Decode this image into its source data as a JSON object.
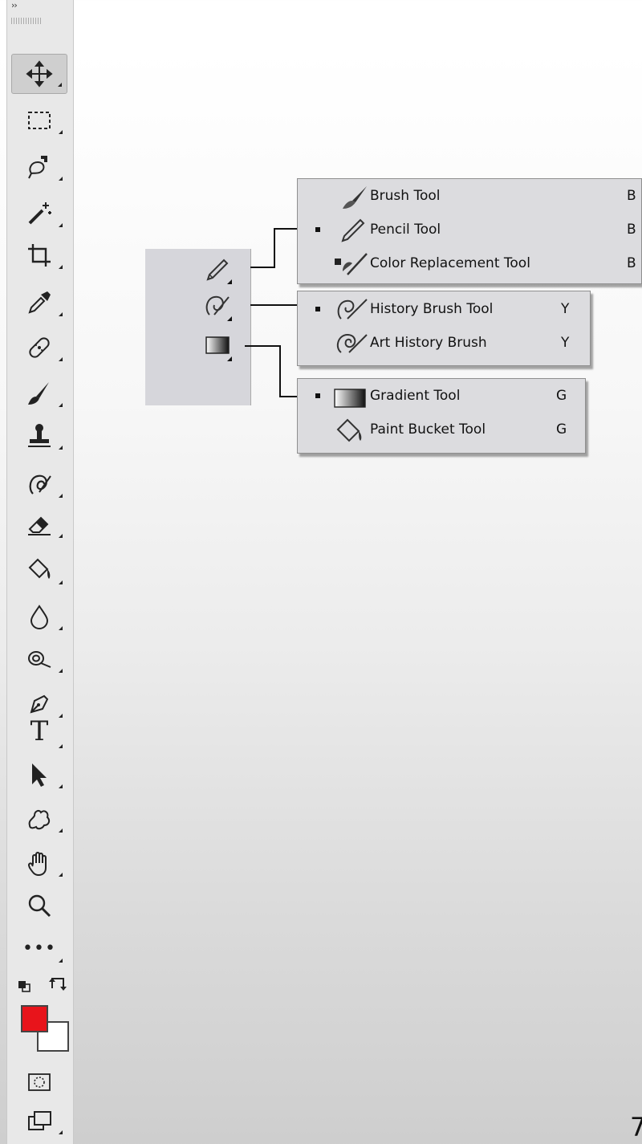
{
  "toolbar": {
    "expand_label": "››",
    "tools": [
      {
        "name": "move-tool",
        "icon": "move-icon"
      },
      {
        "name": "marquee-tool",
        "icon": "rect-marquee-icon"
      },
      {
        "name": "lasso-tool",
        "icon": "magnetic-lasso-icon"
      },
      {
        "name": "magic-wand-tool",
        "icon": "magic-wand-icon"
      },
      {
        "name": "crop-tool",
        "icon": "crop-icon"
      },
      {
        "name": "eyedropper-tool",
        "icon": "eyedropper-icon"
      },
      {
        "name": "healing-brush-tool",
        "icon": "bandage-icon"
      },
      {
        "name": "brush-tool",
        "icon": "brush-icon"
      },
      {
        "name": "clone-stamp-tool",
        "icon": "stamp-icon"
      },
      {
        "name": "history-brush-tool",
        "icon": "history-brush-icon"
      },
      {
        "name": "eraser-tool",
        "icon": "eraser-icon"
      },
      {
        "name": "paint-bucket-tool",
        "icon": "paint-bucket-icon"
      },
      {
        "name": "blur-tool",
        "icon": "drop-icon"
      },
      {
        "name": "dodge-tool",
        "icon": "dodge-icon"
      },
      {
        "name": "pen-tool",
        "icon": "pen-icon"
      },
      {
        "name": "type-tool",
        "icon": "type-icon"
      },
      {
        "name": "path-selection-tool",
        "icon": "arrow-icon"
      },
      {
        "name": "custom-shape-tool",
        "icon": "puzzle-icon"
      },
      {
        "name": "hand-tool",
        "icon": "hand-icon"
      },
      {
        "name": "zoom-tool",
        "icon": "magnifier-icon"
      },
      {
        "name": "more-tools",
        "icon": "ellipsis-icon"
      }
    ],
    "type_glyph": "T",
    "more_glyph": "•••",
    "foreground_color": "#e8141b",
    "background_color": "#ffffff"
  },
  "flyouts": {
    "brush_group": [
      {
        "label": "Brush Tool",
        "key": "B",
        "selected": false,
        "icon": "brush-icon"
      },
      {
        "label": "Pencil Tool",
        "key": "B",
        "selected": true,
        "icon": "pencil-icon"
      },
      {
        "label": "Color Replacement Tool",
        "key": "B",
        "selected": false,
        "icon": "color-replacement-icon"
      }
    ],
    "history_group": [
      {
        "label": "History Brush Tool",
        "key": "Y",
        "selected": true,
        "icon": "history-brush-icon"
      },
      {
        "label": "Art History Brush",
        "key": "Y",
        "selected": false,
        "icon": "art-history-brush-icon"
      }
    ],
    "gradient_group": [
      {
        "label": "Gradient Tool",
        "key": "G",
        "selected": true,
        "icon": "gradient-icon"
      },
      {
        "label": "Paint Bucket Tool",
        "key": "G",
        "selected": false,
        "icon": "paint-bucket-icon"
      }
    ]
  },
  "page_number": "7"
}
